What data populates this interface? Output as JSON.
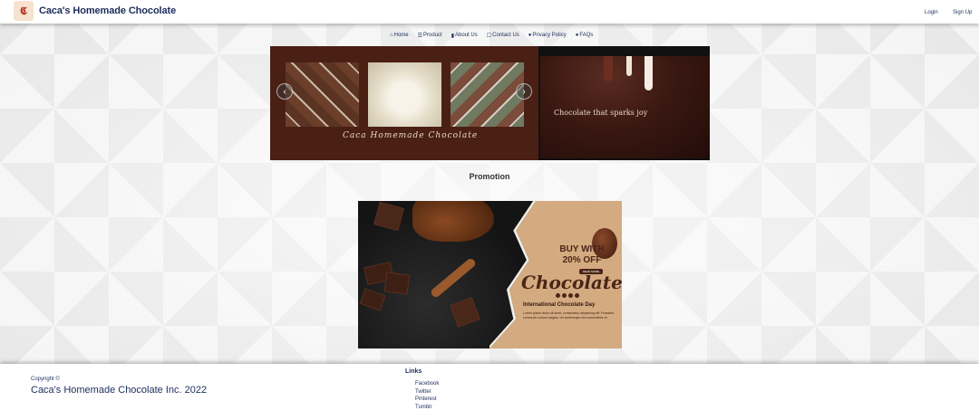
{
  "header": {
    "logo_glyph": "𝕮",
    "brand": "Caca's Homemade Chocolate",
    "login": "Login",
    "signup": "Sign Up"
  },
  "nav": {
    "items": [
      {
        "label": "Home",
        "icon": "home-icon"
      },
      {
        "label": "Product",
        "icon": "list-icon"
      },
      {
        "label": "About Us",
        "icon": "bookmark-icon"
      },
      {
        "label": "Contact Us",
        "icon": "phone-icon"
      },
      {
        "label": "Privacy Policy",
        "icon": "info-icon"
      },
      {
        "label": "FAQs",
        "icon": "help-icon"
      }
    ]
  },
  "carousel": {
    "script_text": "Caca Homemade Chocolate",
    "tagline": "Chocolate that sparks joy",
    "prev_glyph": "‹",
    "next_glyph": "›"
  },
  "promotion": {
    "title": "Promotion",
    "buy_line1": "BUY WITH",
    "buy_line2": "20% OFF",
    "read_more": "READ MORE",
    "headline": "Chocolate",
    "subheadline": "International Chocolate Day",
    "body": "Lorem ipsum dolor sit amet, consectetur adipiscing elit. Praesent commodo cursus magna, vel scelerisque nisl consectetur et."
  },
  "footer": {
    "copyright_label": "Copyright ©",
    "copyright_text": "Caca's Homemade Chocolate Inc. 2022",
    "links_title": "Links",
    "links": [
      "Facebook",
      "Twitter",
      "Pinterest",
      "Tumblr"
    ]
  },
  "colors": {
    "brand": "#1b2d5b",
    "chocolate": "#4a2015"
  }
}
